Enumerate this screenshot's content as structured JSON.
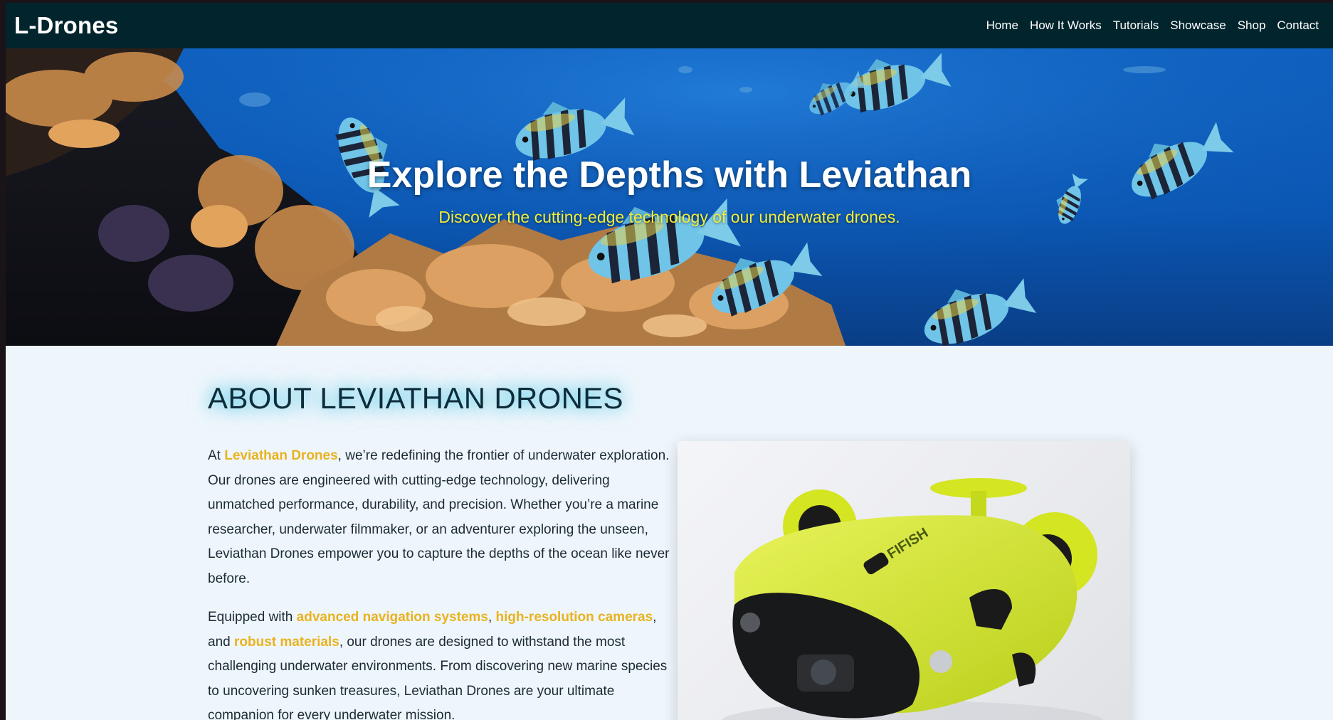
{
  "nav": {
    "logo": "L-Drones",
    "links": [
      "Home",
      "How It Works",
      "Tutorials",
      "Showcase",
      "Shop",
      "Contact"
    ]
  },
  "hero": {
    "title": "Explore the Depths with Leviathan",
    "subtitle": "Discover the cutting-edge technology of our underwater drones."
  },
  "about": {
    "title": "ABOUT LEVIATHAN DRONES",
    "p1": {
      "t1": "At ",
      "h1": "Leviathan Drones",
      "t2": ", we’re redefining the frontier of underwater exploration. Our drones are engineered with cutting-edge technology, delivering unmatched performance, durability, and precision. Whether you’re a marine researcher, underwater filmmaker, or an adventurer exploring the unseen, Leviathan Drones empower you to capture the depths of the ocean like never before."
    },
    "p2": {
      "t1": "Equipped with ",
      "h1": "advanced navigation systems",
      "t2": ", ",
      "h2": "high-resolution cameras",
      "t3": ", and ",
      "h3": "robust materials",
      "t4": ", our drones are designed to withstand the most challenging underwater environments. From discovering new marine species to uncovering sunken treasures, Leviathan Drones are your ultimate companion for every underwater mission."
    },
    "product_logo_text": "FIFISH"
  },
  "colors": {
    "nav_bg": "#02242c",
    "highlight": "#e9b21f",
    "subtitle": "#f2ee3a",
    "drone_body": "#d6e82a"
  }
}
